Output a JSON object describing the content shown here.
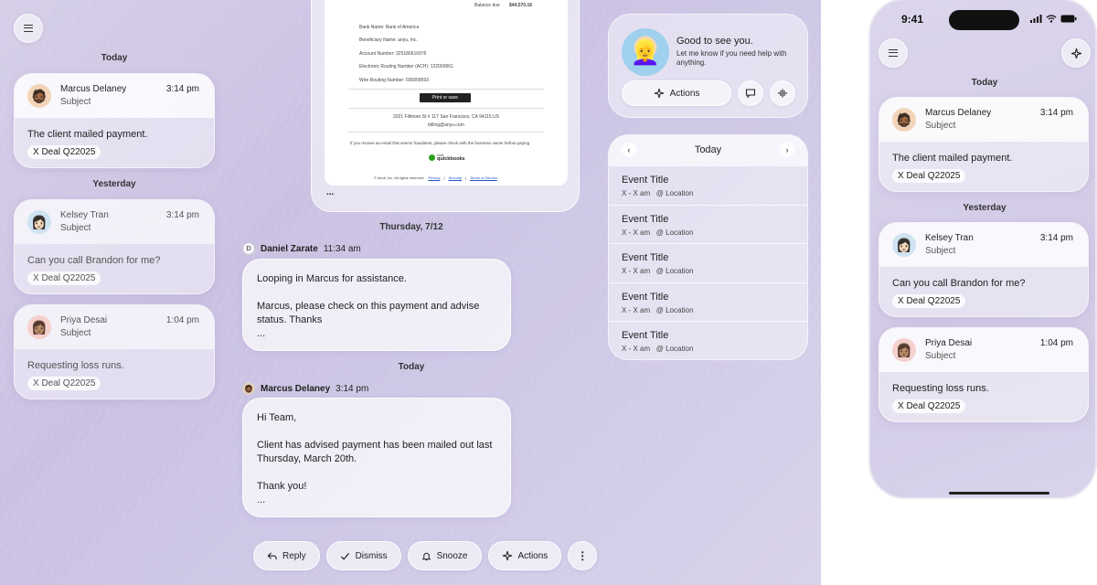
{
  "sidebar": {
    "sections": [
      {
        "label": "Today"
      },
      {
        "label": "Yesterday"
      }
    ],
    "cards": [
      {
        "name": "Marcus Delaney",
        "subject": "Subject",
        "time": "3:14 pm",
        "body": "The client mailed payment.",
        "tag": "X Deal Q22025"
      },
      {
        "name": "Kelsey Tran",
        "subject": "Subject",
        "time": "3:14 pm",
        "body": "Can you call Brandon for me?",
        "tag": "X Deal Q22025"
      },
      {
        "name": "Priya Desai",
        "subject": "Subject",
        "time": "1:04 pm",
        "body": "Requesting loss runs.",
        "tag": "X Deal Q22025"
      }
    ]
  },
  "invoice": {
    "balance_label": "Balance due",
    "balance_value": "$44,570.16",
    "lines": [
      "Bank Name: Bank of America",
      "Beneficiary Name: anyu, Inc.",
      "Account Number: 325180616976",
      "Electronic Routing Number (ACH): 122000661",
      "Wire Routing Number: 026009593"
    ],
    "print_button": "Print or save",
    "address": "2021 Fillmore St # 117 San Francisco, CA 94115 US",
    "email": "billing@anyu.com",
    "fraud_note": "If you receive an email that seems fraudulent, please check with the business owner before paying.",
    "brand": "quickbooks",
    "brand_prefix": "intuit",
    "footer": "© Intuit, Inc. All rights reserved.",
    "links": [
      "Privacy",
      "Security",
      "Terms of Service"
    ],
    "more": "..."
  },
  "thread": {
    "date_label": "Thursday, 7/12",
    "today_label": "Today",
    "messages": [
      {
        "initial": "D",
        "sender": "Daniel Zarate",
        "time": "11:34 am",
        "paragraphs": [
          "Looping in Marcus for assistance.",
          "Marcus, please check on this payment and advise status. Thanks"
        ],
        "more": "..."
      },
      {
        "initial": "",
        "sender": "Marcus Delaney",
        "time": "3:14 pm",
        "paragraphs": [
          "Hi Team,",
          "Client has advised payment has been mailed out last Thursday, March 20th.",
          "Thank you!"
        ],
        "more": "..."
      }
    ]
  },
  "toolbar": {
    "reply": "Reply",
    "dismiss": "Dismiss",
    "snooze": "Snooze",
    "actions": "Actions",
    "more": "⋮"
  },
  "assistant": {
    "greeting": "Good to see you.",
    "subtext": "Let me know if you need help with anything.",
    "actions_label": "Actions"
  },
  "calendar": {
    "title": "Today",
    "events": [
      {
        "title": "Event Title",
        "time": "X - X am",
        "location": "@ Location"
      },
      {
        "title": "Event Title",
        "time": "X - X am",
        "location": "@ Location"
      },
      {
        "title": "Event Title",
        "time": "X - X am",
        "location": "@ Location"
      },
      {
        "title": "Event Title",
        "time": "X - X am",
        "location": "@ Location"
      },
      {
        "title": "Event Title",
        "time": "X - X am",
        "location": "@ Location"
      }
    ]
  },
  "phone": {
    "clock": "9:41",
    "sections": [
      {
        "label": "Today"
      },
      {
        "label": "Yesterday"
      }
    ],
    "cards": [
      {
        "name": "Marcus Delaney",
        "subject": "Subject",
        "time": "3:14 pm",
        "body": "The client mailed payment.",
        "tag": "X Deal Q22025"
      },
      {
        "name": "Kelsey Tran",
        "subject": "Subject",
        "time": "3:14 pm",
        "body": "Can you call Brandon for me?",
        "tag": "X Deal Q22025"
      },
      {
        "name": "Priya Desai",
        "subject": "Subject",
        "time": "1:04 pm",
        "body": "Requesting loss runs.",
        "tag": "X Deal Q22025"
      }
    ]
  },
  "colors": {
    "background": "#cfc8e6",
    "accent": "#6b5fa8"
  }
}
